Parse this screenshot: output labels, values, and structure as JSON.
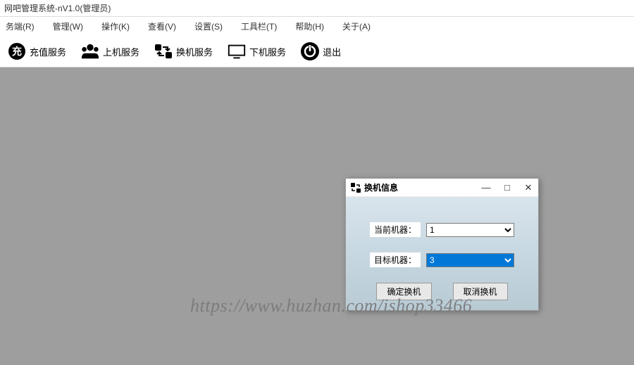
{
  "window": {
    "title": "网吧管理系统-nV1.0(管理员)"
  },
  "menu": {
    "items": [
      {
        "label": "务端(R)"
      },
      {
        "label": "管理(W)"
      },
      {
        "label": "操作(K)"
      },
      {
        "label": "查看(V)"
      },
      {
        "label": "设置(S)"
      },
      {
        "label": "工具栏(T)"
      },
      {
        "label": "帮助(H)"
      },
      {
        "label": "关于(A)"
      }
    ]
  },
  "toolbar": {
    "items": [
      {
        "icon": "recharge-icon",
        "label": "充值服务"
      },
      {
        "icon": "users-icon",
        "label": "上机服务"
      },
      {
        "icon": "swap-icon",
        "label": "换机服务"
      },
      {
        "icon": "monitor-icon",
        "label": "下机服务"
      },
      {
        "icon": "power-icon",
        "label": "退出"
      }
    ]
  },
  "dialog": {
    "title": "换机信息",
    "current_label": "当前机器：",
    "current_value": "1",
    "target_label": "目标机器：",
    "target_value": "3",
    "confirm_label": "确定换机",
    "cancel_label": "取消换机"
  },
  "watermark": "https://www.huzhan.com/ishop33466"
}
